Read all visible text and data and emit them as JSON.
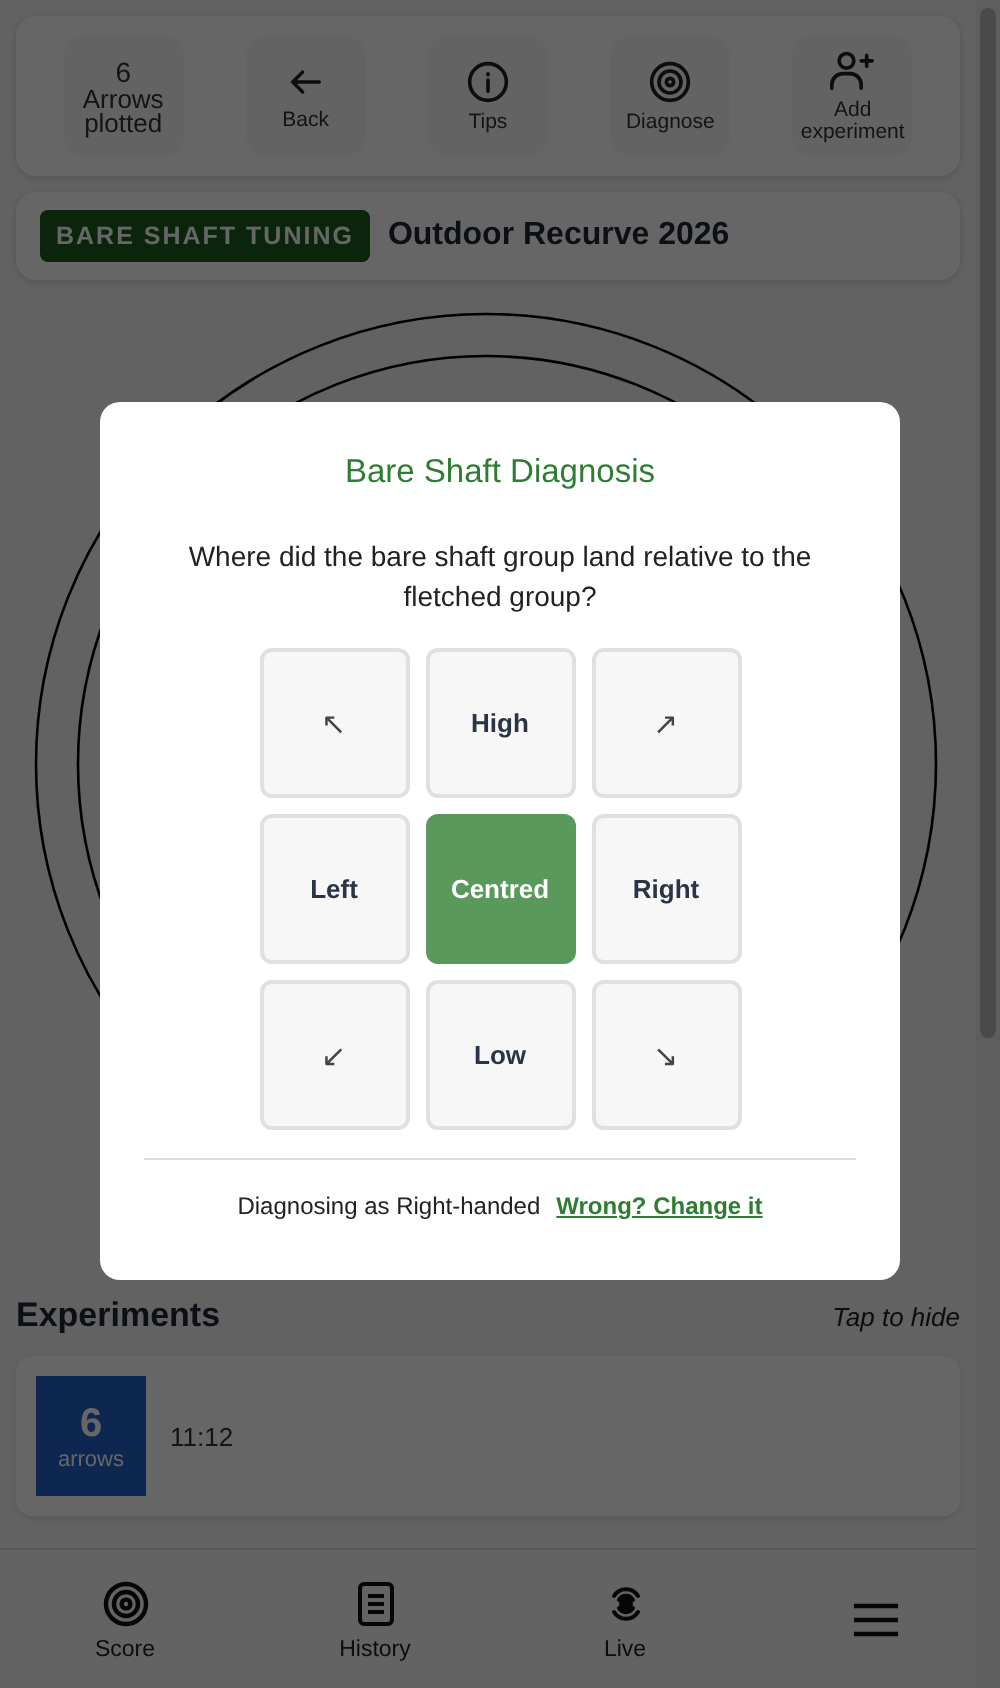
{
  "toolbar": {
    "count": "6",
    "count_label": "Arrows plotted",
    "buttons": [
      {
        "label": "Back"
      },
      {
        "label": "Tips"
      },
      {
        "label": "Diagnose"
      },
      {
        "label": "Add experiment"
      }
    ]
  },
  "session": {
    "badge": "BARE SHAFT TUNING",
    "title": "Outdoor Recurve 2026"
  },
  "experiments": {
    "title": "Experiments",
    "hint": "Tap to hide",
    "items": [
      {
        "count": "6",
        "unit": "arrows",
        "time": "11:12"
      }
    ]
  },
  "nav": [
    {
      "kind": "tab",
      "label": "Score"
    },
    {
      "kind": "tab",
      "label": "History"
    },
    {
      "kind": "tab",
      "label": "Live"
    },
    {
      "kind": "menu"
    }
  ],
  "dialog": {
    "title": "Bare Shaft Diagnosis",
    "question": "Where did the bare shaft group land relative to the fletched group?",
    "options": [
      {
        "label": "↖",
        "kind": "arrow",
        "selected": false
      },
      {
        "label": "High",
        "kind": "word",
        "selected": false
      },
      {
        "label": "↗",
        "kind": "arrow",
        "selected": false
      },
      {
        "label": "Left",
        "kind": "word",
        "selected": false
      },
      {
        "label": "Centred",
        "kind": "word",
        "selected": true
      },
      {
        "label": "Right",
        "kind": "word",
        "selected": false
      },
      {
        "label": "↙",
        "kind": "arrow",
        "selected": false
      },
      {
        "label": "Low",
        "kind": "word",
        "selected": false
      },
      {
        "label": "↘",
        "kind": "arrow",
        "selected": false
      }
    ],
    "footer": "Diagnosing as Right-handed",
    "link": "Wrong? Change it"
  }
}
